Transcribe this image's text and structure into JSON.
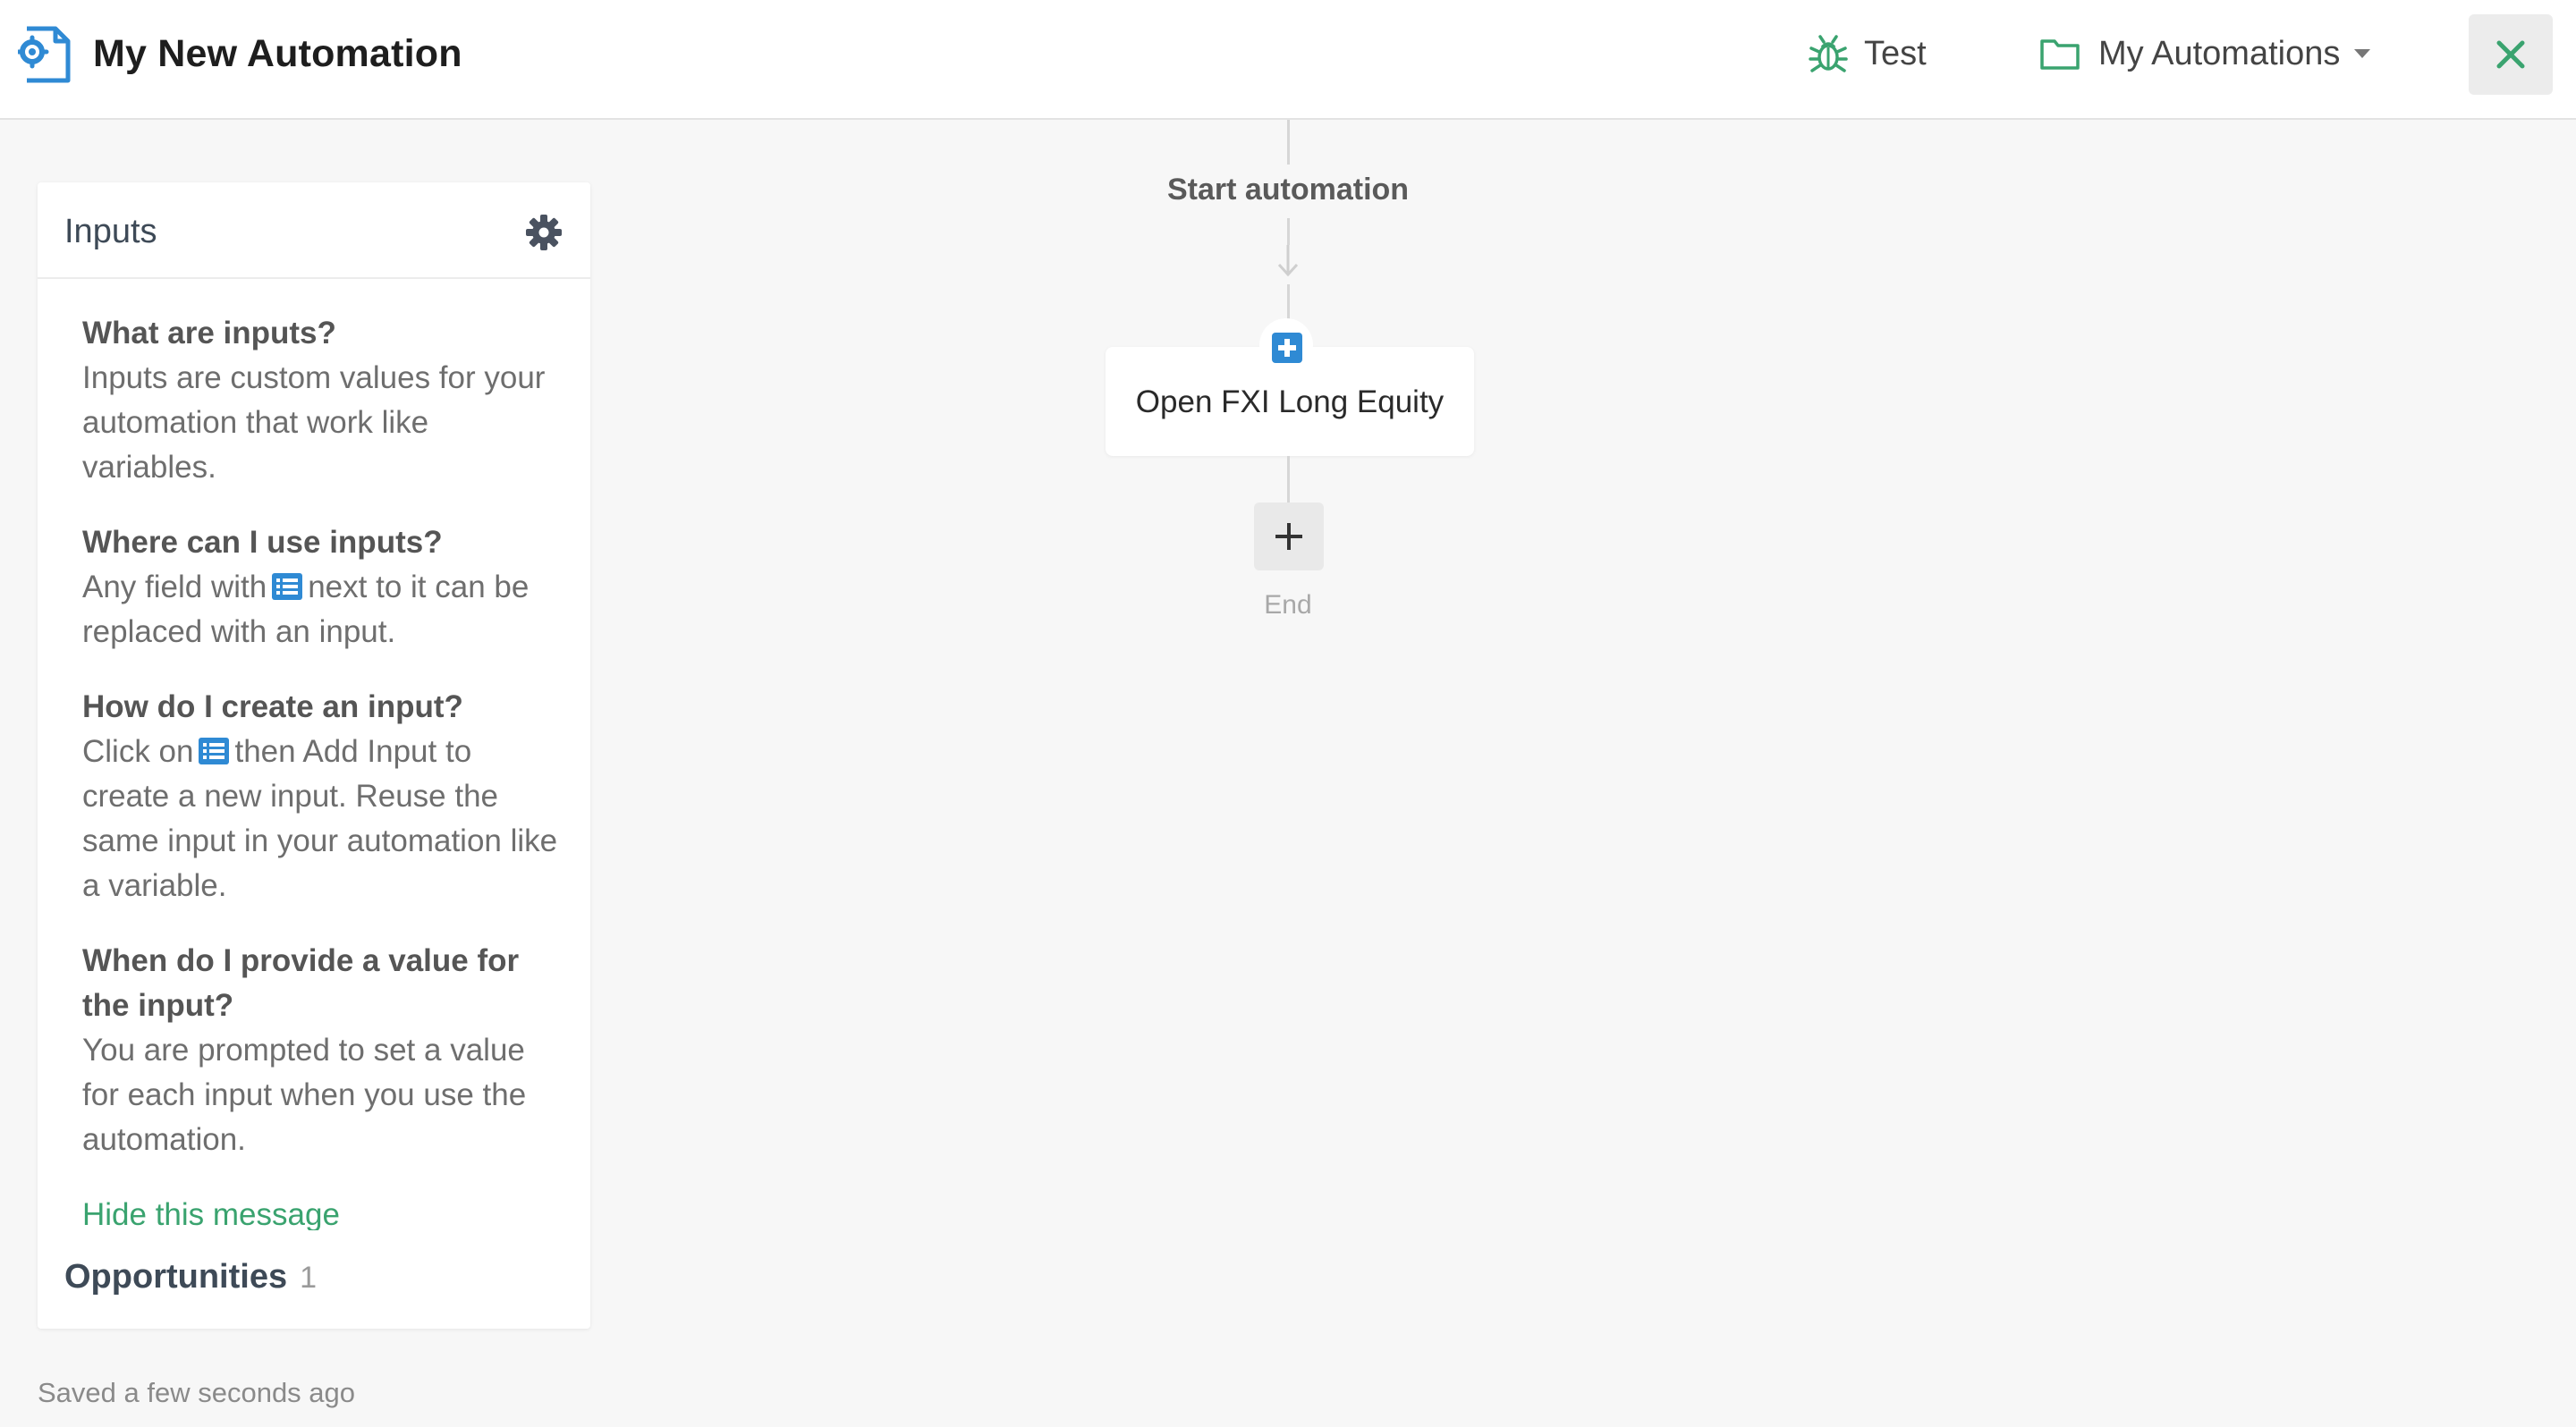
{
  "header": {
    "title": "My New Automation",
    "test_label": "Test",
    "folder_label": "My Automations",
    "icons": {
      "app": "automation-gear-icon",
      "test": "bug-icon",
      "folder": "folder-icon",
      "caret": "caret-down-icon",
      "close": "close-icon"
    }
  },
  "panel": {
    "title": "Inputs",
    "help": [
      {
        "question": "What are inputs?",
        "answer": "Inputs are custom values for your automation that work like variables."
      },
      {
        "question": "Where can I use inputs?",
        "answer_before": "Any field with",
        "answer_after": "next to it can be replaced with an input."
      },
      {
        "question": "How do I create an input?",
        "answer_before": "Click on",
        "answer_after": "then Add Input to create a new input. Reuse the same input in your automation like a variable."
      },
      {
        "question": "When do I provide a value for the input?",
        "answer": "You are prompted to set a value for each input when you use the automation."
      }
    ],
    "hide_link": "Hide this message",
    "opportunities_label": "Opportunities",
    "opportunities_count": "1"
  },
  "flow": {
    "start_label": "Start automation",
    "action_label": "Open FXI Long Equity",
    "end_label": "End"
  },
  "footer": {
    "saved_status": "Saved a few seconds ago"
  },
  "colors": {
    "accent_green": "#3aa36f",
    "accent_blue": "#2f8ad4",
    "close_green": "#3aa36f"
  }
}
